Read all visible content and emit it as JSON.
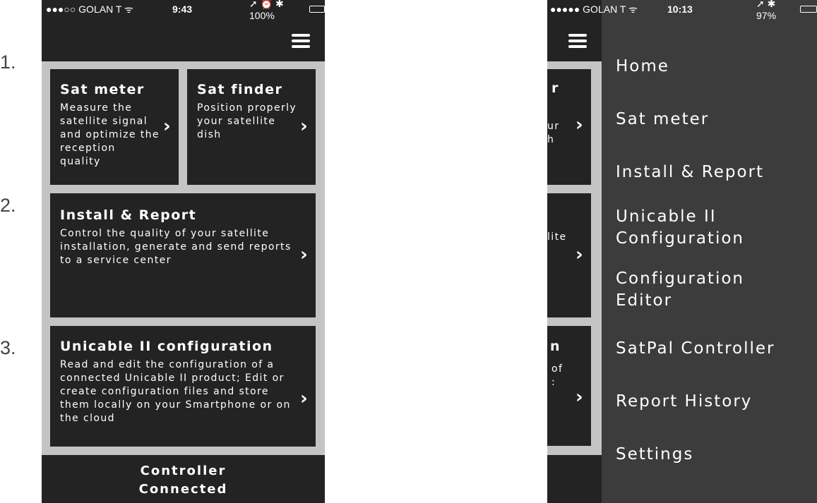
{
  "step_numbers": [
    "1.",
    "2.",
    "3."
  ],
  "screen1": {
    "status": {
      "carrier": "●●●○○ GOLAN T ᯤ",
      "time": "9:43",
      "indicators": "➚ ⏰ ✱ 100%",
      "battery_level": 1.0
    },
    "menu_icon": "hamburger-menu-icon",
    "cards": [
      {
        "title": "Sat meter",
        "description": "Measure the satellite signal and optimize the reception quality"
      },
      {
        "title": "Sat finder",
        "description": "Position properly your satellite dish"
      },
      {
        "title": "Install & Report",
        "description": "Control the quality of your satellite installation, generate and send reports to a service center"
      },
      {
        "title": "Unicable II configuration",
        "description": "Read and edit the configuration of a connected Unicable II product; Edit or create configuration files and store them locally on your Smartphone or on the cloud"
      }
    ],
    "footer": {
      "line1": "Controller",
      "line2": "Connected"
    }
  },
  "screen2": {
    "status": {
      "carrier": "●●●●● GOLAN T ᯤ",
      "time": "10:13",
      "indicators": "➚ ✱ 97%",
      "battery_level": 0.97
    },
    "peek_fragments": {
      "card1_title": "r",
      "card1_text": "ur\nh",
      "card2_text": "lite",
      "card3_title": "n",
      "card3_text": "of\n:"
    },
    "menu": {
      "items": [
        "Home",
        "Sat meter",
        "Install & Report",
        "Unicable II\nConfiguration",
        "Configuration\nEditor",
        "SatPal Controller",
        "Report History",
        "Settings"
      ]
    }
  },
  "colors": {
    "dark": "#232323",
    "menu_bg": "#3c3c3c",
    "gutter": "#c4c4c4"
  }
}
